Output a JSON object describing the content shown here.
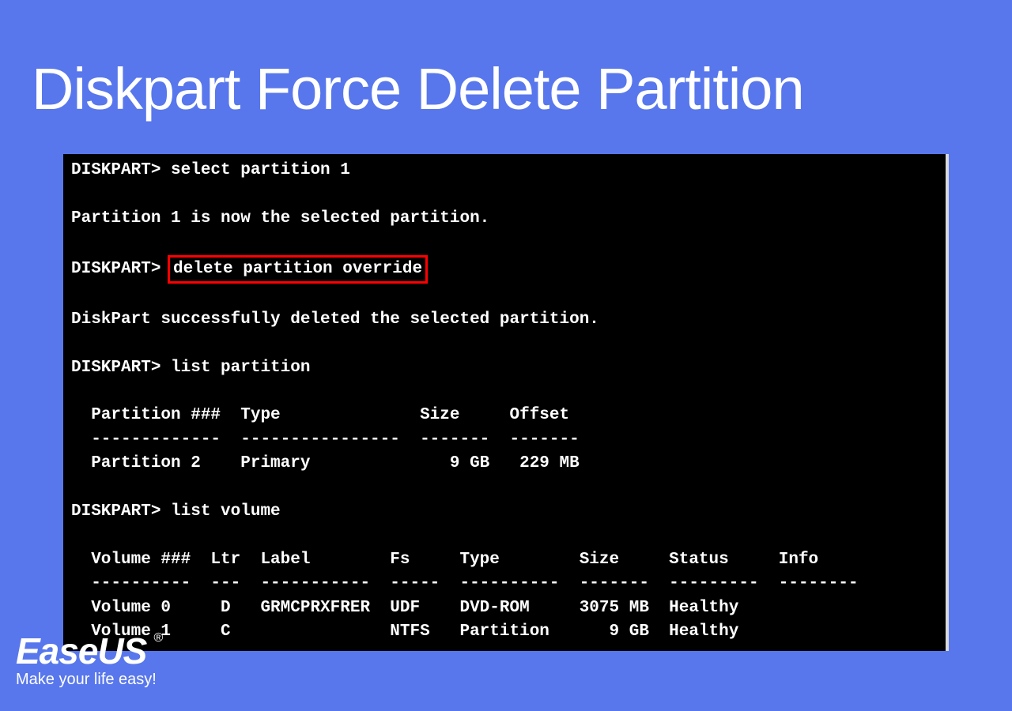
{
  "title": "Diskpart Force Delete Partition",
  "terminal": {
    "l1": "DISKPART> select partition 1",
    "l2": "Partition 1 is now the selected partition.",
    "l3_prompt": "DISKPART> ",
    "l3_cmd": "delete partition override",
    "l4": "DiskPart successfully deleted the selected partition.",
    "l5": "DISKPART> list partition",
    "l6": "  Partition ###  Type              Size     Offset",
    "l7": "  -------------  ----------------  -------  -------",
    "l8": "  Partition 2    Primary              9 GB   229 MB",
    "l9": "DISKPART> list volume",
    "l10": "  Volume ###  Ltr  Label        Fs     Type        Size     Status     Info",
    "l11": "  ----------  ---  -----------  -----  ----------  -------  ---------  --------",
    "l12": "  Volume 0     D   GRMCPRXFRER  UDF    DVD-ROM     3075 MB  Healthy",
    "l13": "  Volume 1     C                NTFS   Partition      9 GB  Healthy"
  },
  "logo": {
    "brand": "EaseUS",
    "reg": "®",
    "tagline": "Make your life easy!"
  }
}
